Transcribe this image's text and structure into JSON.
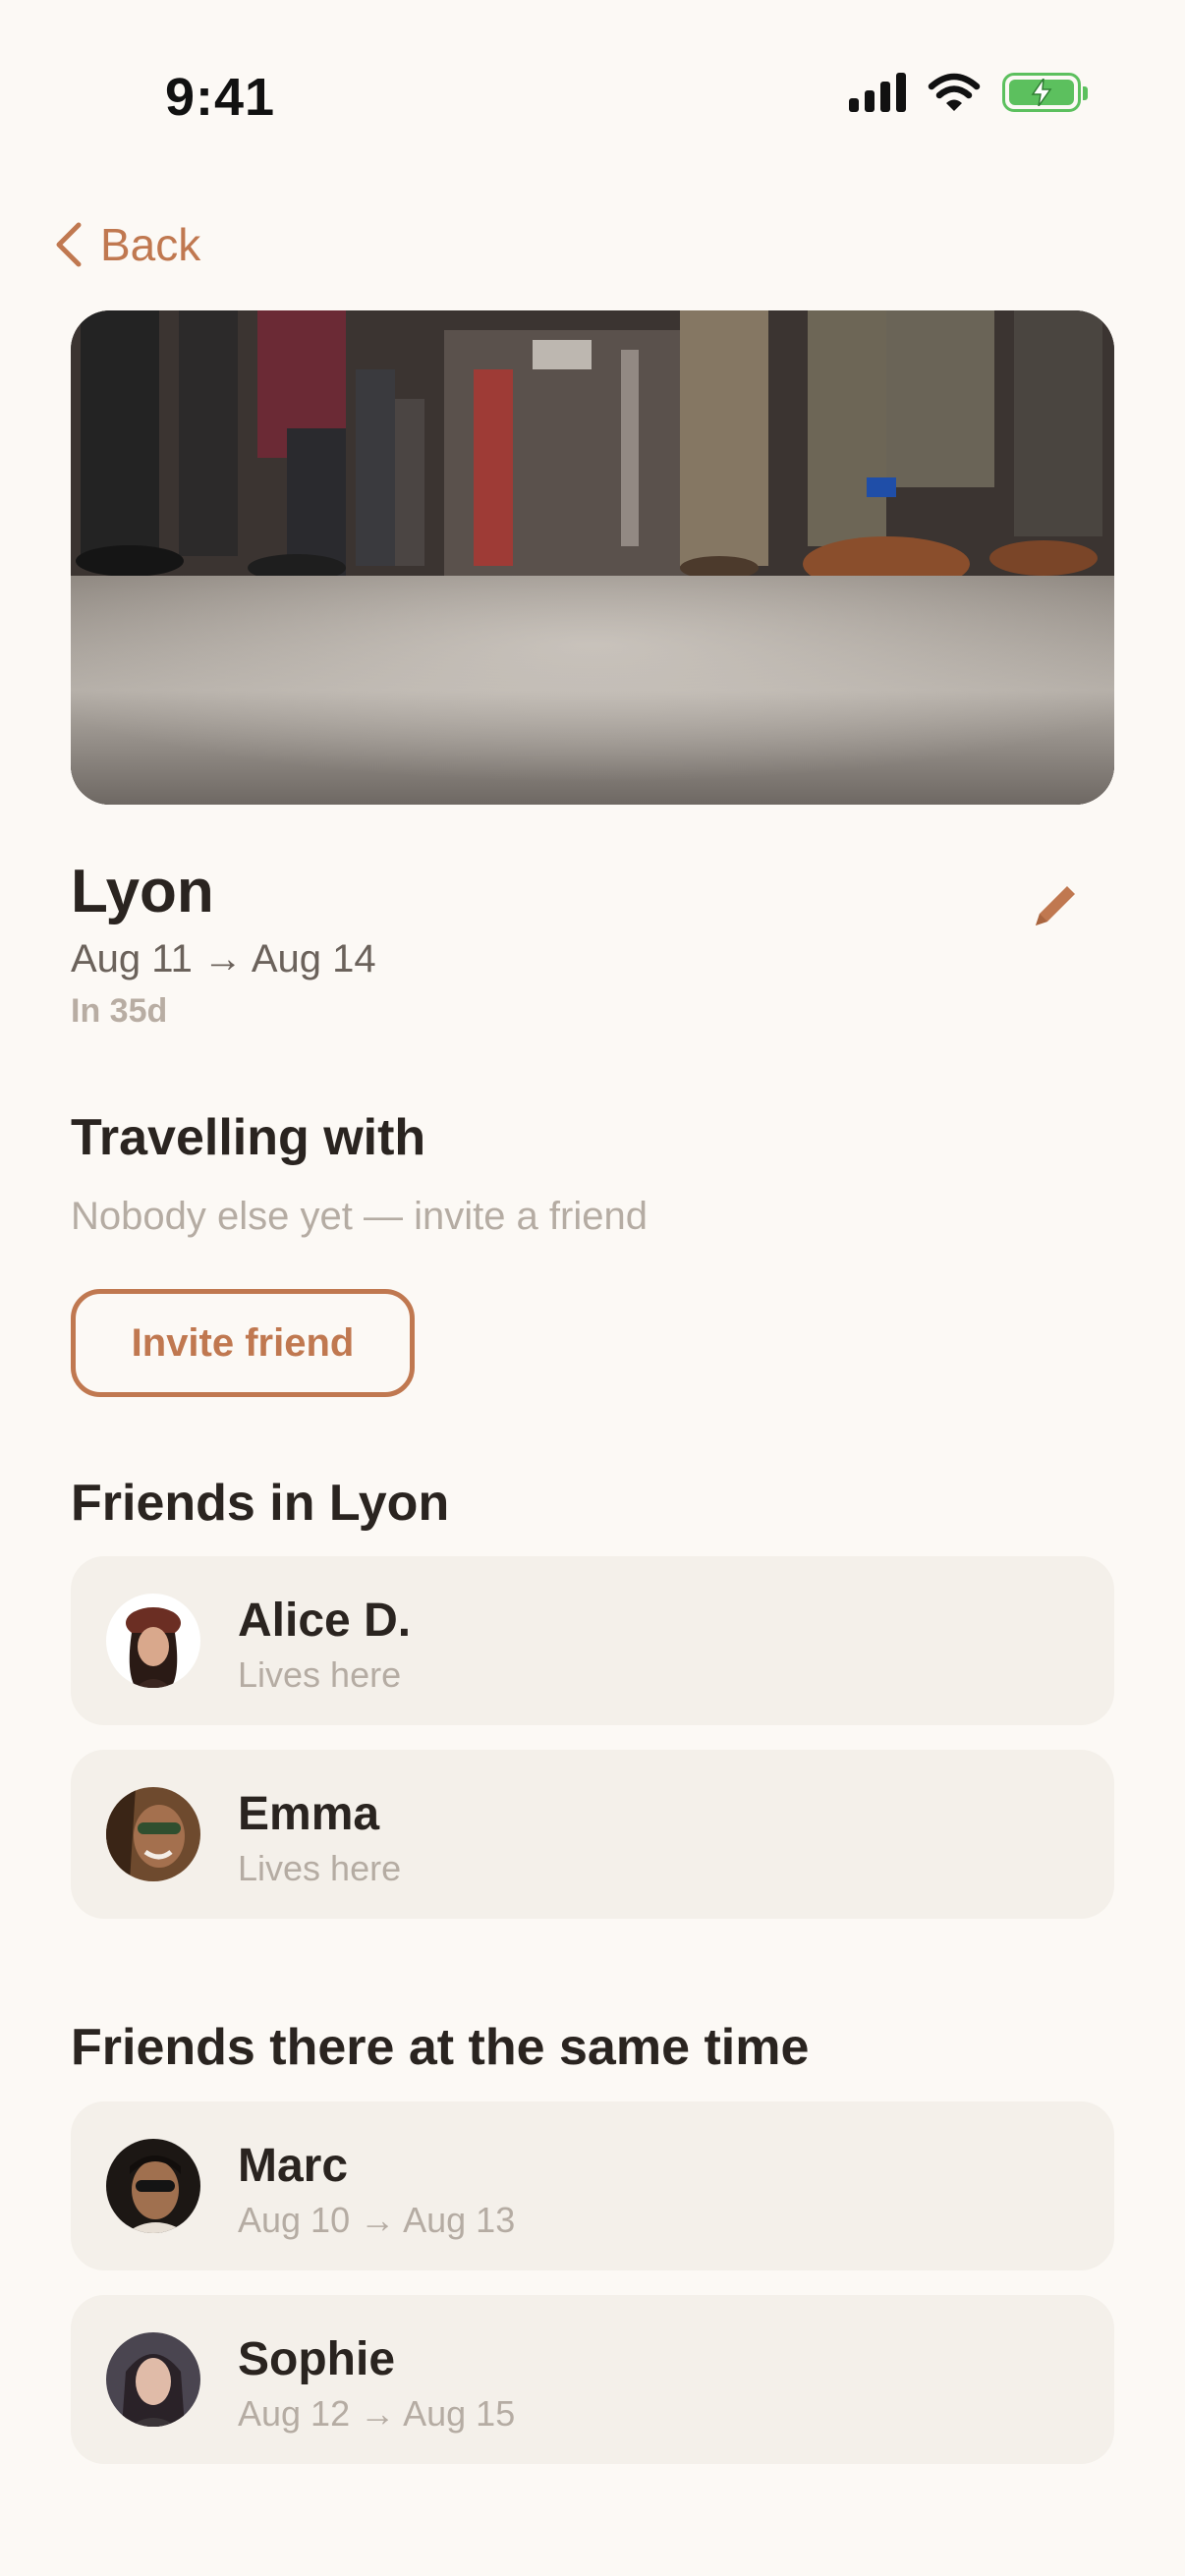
{
  "status_bar": {
    "time": "9:41"
  },
  "nav": {
    "back_label": "Back"
  },
  "trip": {
    "city": "Lyon",
    "dates": "Aug 11 → Aug 14",
    "countdown": "In 35d"
  },
  "travelling_with": {
    "heading": "Travelling with",
    "empty_text": "Nobody else yet — invite a friend",
    "invite_label": "Invite friend"
  },
  "friends_in_city": {
    "heading": "Friends in Lyon",
    "items": [
      {
        "name": "Alice D.",
        "subtitle": "Lives here"
      },
      {
        "name": "Emma",
        "subtitle": "Lives here"
      }
    ]
  },
  "friends_same_time": {
    "heading": "Friends there at the same time",
    "items": [
      {
        "name": "Marc",
        "subtitle": "Aug 10 → Aug 13"
      },
      {
        "name": "Sophie",
        "subtitle": "Aug 12 → Aug 15"
      }
    ]
  },
  "colors": {
    "accent": "#C07850",
    "background": "#FCF9F5",
    "card": "#F4F0EA",
    "muted": "#B5ACA3",
    "battery": "#5CC05E"
  },
  "icons": [
    "cellular-signal-icon",
    "wifi-icon",
    "battery-charging-icon",
    "chevron-left-icon",
    "pencil-icon"
  ]
}
